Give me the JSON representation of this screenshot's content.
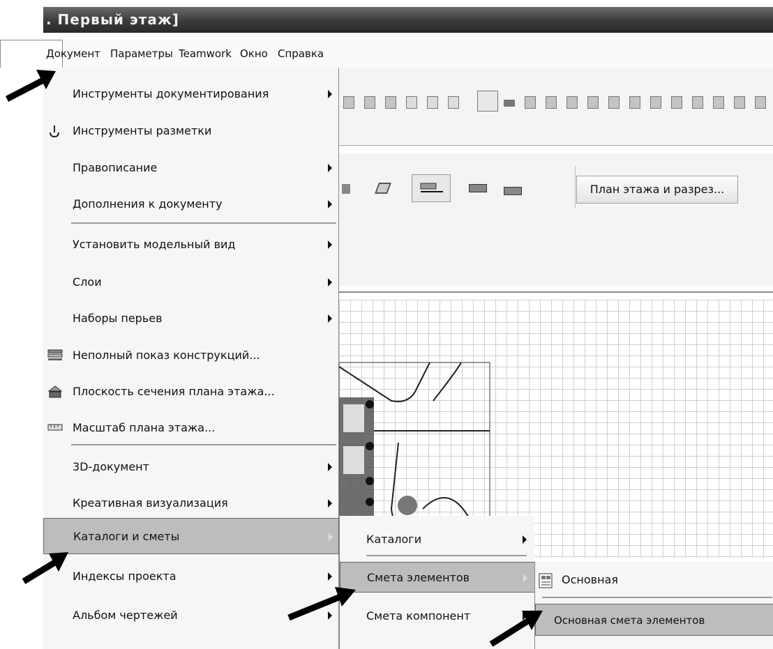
{
  "window": {
    "title": ". Первый этаж]"
  },
  "menubar": {
    "items": [
      "Документ",
      "Параметры",
      "Teamwork",
      "Окно",
      "Справка"
    ]
  },
  "toolbar": {
    "plan_button_label": "План этажа и разрез..."
  },
  "menu": {
    "items": [
      {
        "label": "Инструменты документирования",
        "submenu": true
      },
      {
        "label": "Инструменты разметки",
        "icon": "markup-pen-icon",
        "submenu": false
      },
      {
        "label": "Правописание",
        "submenu": true
      },
      {
        "label": "Дополнения к документу",
        "submenu": true
      },
      {
        "label": "Установить модельный вид",
        "submenu": true
      },
      {
        "label": "Слои",
        "submenu": true
      },
      {
        "label": "Наборы перьев",
        "submenu": true
      },
      {
        "label": "Неполный показ конструкций...",
        "icon": "partial-structure-icon",
        "submenu": false
      },
      {
        "label": "Плоскость сечения плана этажа...",
        "icon": "cut-plane-icon",
        "submenu": false
      },
      {
        "label": "Масштаб плана этажа...",
        "icon": "scale-ruler-icon",
        "submenu": false
      },
      {
        "label": "3D-документ",
        "submenu": true
      },
      {
        "label": "Креативная визуализация",
        "submenu": true
      },
      {
        "label": "Каталоги и сметы",
        "submenu": true,
        "selected": true
      },
      {
        "label": "Индексы проекта",
        "submenu": true
      },
      {
        "label": "Альбом чертежей",
        "submenu": true
      }
    ]
  },
  "submenu1": {
    "items": [
      {
        "label": "Каталоги",
        "submenu": true
      },
      {
        "label": "Смета элементов",
        "submenu": true,
        "selected": true
      },
      {
        "label": "Смета компонент",
        "submenu": true
      }
    ]
  },
  "submenu2": {
    "items": [
      {
        "label": "Основная",
        "icon": "schedule-icon"
      },
      {
        "label": "Основная смета элементов",
        "selected": true
      }
    ]
  }
}
